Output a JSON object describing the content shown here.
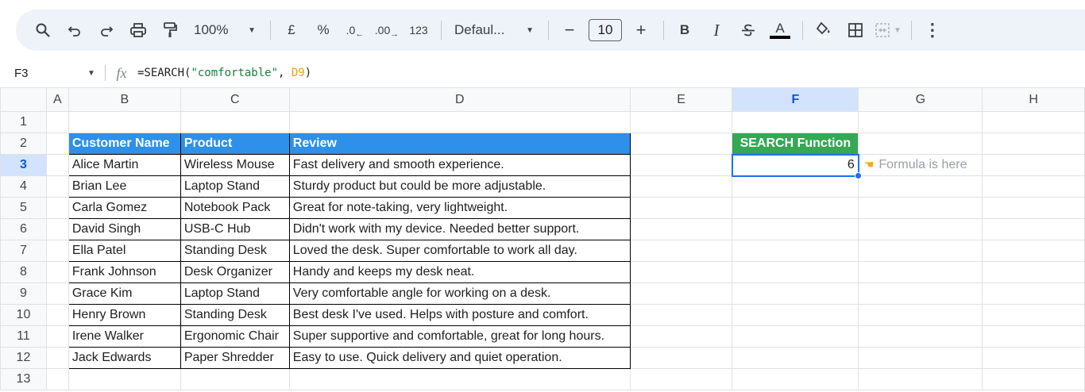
{
  "toolbar": {
    "zoom": "100%",
    "currency": "£",
    "percent": "%",
    "decrease_decimal": ".0",
    "increase_decimal": ".00",
    "number_format": "123",
    "font_family": "Defaul...",
    "font_size": "10",
    "minus": "−",
    "plus": "+",
    "bold": "B",
    "italic": "I",
    "text_color_glyph": "A",
    "more": "⋮"
  },
  "formula_bar": {
    "cell_ref": "F3",
    "fx": "fx",
    "formula_prefix": "=SEARCH(",
    "formula_string": "\"comfortable\"",
    "formula_sep": ", ",
    "formula_ref": "D9",
    "formula_suffix": ")"
  },
  "columns": [
    "A",
    "B",
    "C",
    "D",
    "E",
    "F",
    "G",
    "H"
  ],
  "rows": [
    "1",
    "2",
    "3",
    "4",
    "5",
    "6",
    "7",
    "8",
    "9",
    "10",
    "11",
    "12",
    "13"
  ],
  "table": {
    "headers": [
      "Customer Name",
      "Product",
      "Review"
    ],
    "data": [
      [
        "Alice Martin",
        "Wireless Mouse",
        "Fast delivery and smooth experience."
      ],
      [
        "Brian Lee",
        "Laptop Stand",
        "Sturdy product but could be more adjustable."
      ],
      [
        "Carla Gomez",
        "Notebook Pack",
        "Great for note-taking, very lightweight."
      ],
      [
        "David Singh",
        "USB-C Hub",
        "Didn't work with my device. Needed better support."
      ],
      [
        "Ella Patel",
        "Standing Desk",
        "Loved the desk. Super comfortable to work all day."
      ],
      [
        "Frank Johnson",
        "Desk Organizer",
        "Handy and keeps my desk neat."
      ],
      [
        "Grace Kim",
        "Laptop Stand",
        "Very comfortable angle for working on a desk."
      ],
      [
        "Henry Brown",
        "Standing Desk",
        "Best desk I've used. Helps with posture and comfort."
      ],
      [
        "Irene Walker",
        "Ergonomic Chair",
        "Super supportive and comfortable, great for long hours."
      ],
      [
        "Jack Edwards",
        "Paper Shredder",
        "Easy to use. Quick delivery and quiet operation."
      ]
    ]
  },
  "search_block": {
    "header": "SEARCH Function",
    "result": "6",
    "annotation": "Formula is here"
  },
  "colors": {
    "header_blue": "#2e90e8",
    "header_green": "#34a853",
    "selection": "#1a73e8",
    "formula_string": "#188038",
    "formula_ref": "#f4a300"
  }
}
